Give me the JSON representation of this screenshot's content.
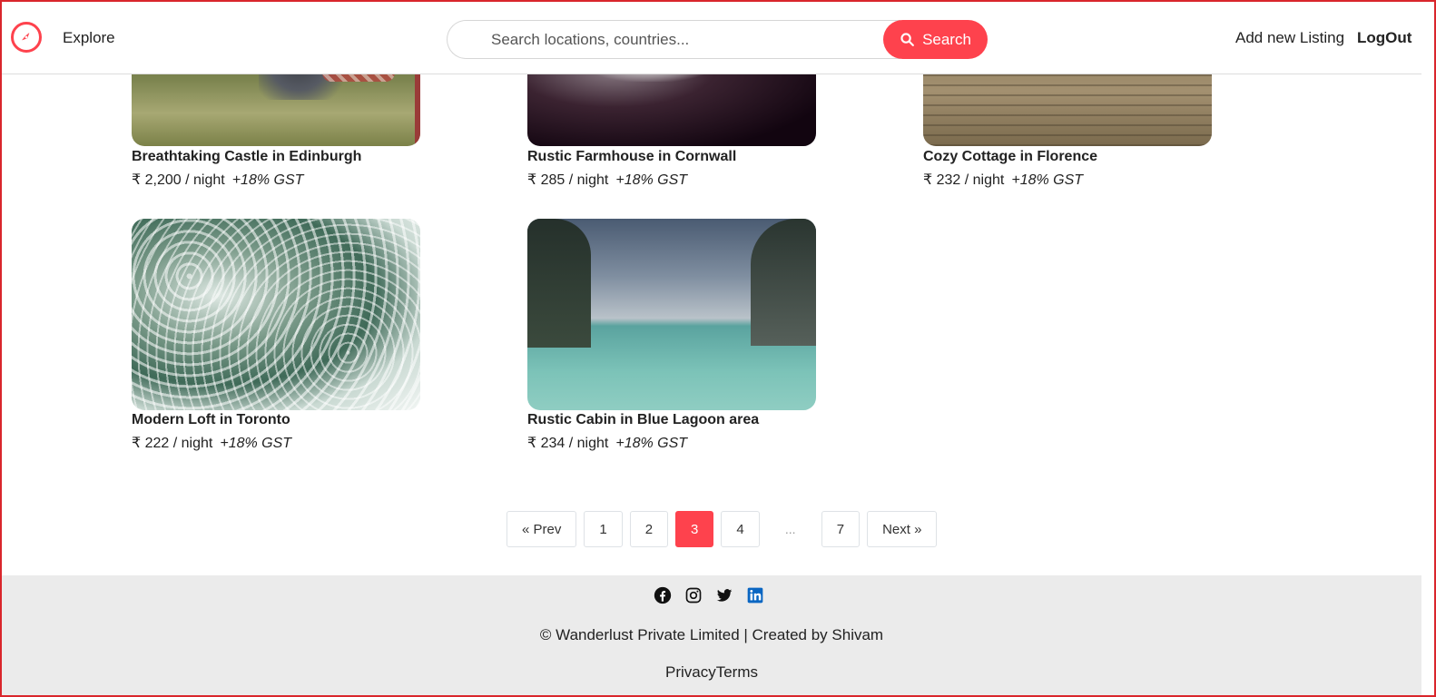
{
  "nav": {
    "explore_label": "Explore",
    "search_placeholder": "Search locations, countries...",
    "search_button_label": "Search",
    "add_listing_label": "Add new Listing",
    "logout_label": "LogOut",
    "accent_color": "#fe424d"
  },
  "listings": [
    {
      "title": "Breathtaking Castle in Edinburgh",
      "price": "₹ 2,200 / night",
      "tax": "+18% GST"
    },
    {
      "title": "Rustic Farmhouse in Cornwall",
      "price": "₹ 285 / night",
      "tax": "+18% GST"
    },
    {
      "title": "Cozy Cottage in Florence",
      "price": "₹ 232 / night",
      "tax": "+18% GST"
    },
    {
      "title": "Modern Loft in Toronto",
      "price": "₹ 222 / night",
      "tax": "+18% GST"
    },
    {
      "title": "Rustic Cabin in Blue Lagoon area",
      "price": "₹ 234 / night",
      "tax": "+18% GST"
    }
  ],
  "pagination": {
    "prev_label": "« Prev",
    "pages": [
      "1",
      "2",
      "3",
      "4"
    ],
    "ellipsis": "...",
    "last_page": "7",
    "next_label": "Next »",
    "current_page": 3
  },
  "footer": {
    "social_icons": [
      "facebook-icon",
      "instagram-icon",
      "twitter-icon",
      "linkedin-icon"
    ],
    "copyright": "© Wanderlust Private Limited | Created by Shivam",
    "privacy_label": "Privacy",
    "terms_label": "Terms"
  }
}
